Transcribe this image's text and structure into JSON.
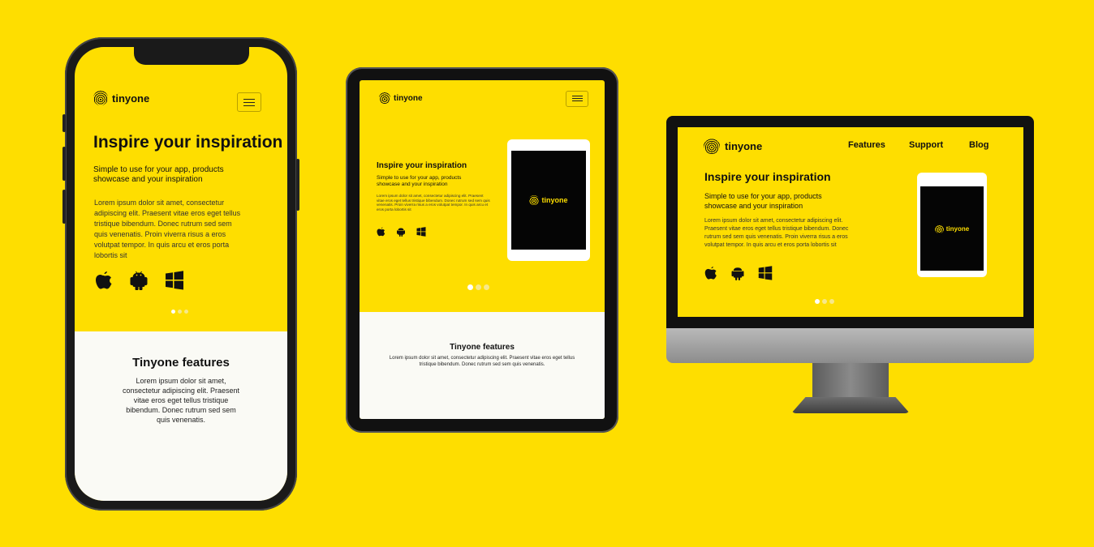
{
  "brand": {
    "name": "tinyone",
    "icon": "fingerprint-icon"
  },
  "hero": {
    "title": "Inspire your inspiration",
    "subtitle_line1": "Simple to use for your app, products",
    "subtitle_line2": "showcase and your inspiration",
    "body": "Lorem ipsum dolor sit amet, consectetur adipiscing elit. Praesent vitae eros eget tellus tristique bibendum. Donec rutrum sed sem quis venenatis. Proin viverra risus a eros volutpat tempor. In quis arcu et eros porta lobortis sit"
  },
  "platforms": [
    "apple-icon",
    "android-icon",
    "windows-icon"
  ],
  "carousel": {
    "count": 3,
    "active": 1
  },
  "features": {
    "title": "Tinyone features",
    "body": "Lorem ipsum dolor sit amet, consectetur adipiscing elit. Praesent vitae eros eget tellus tristique bibendum. Donec rutrum sed sem quis venenatis."
  },
  "nav": {
    "features": "Features",
    "support": "Support",
    "blog": "Blog"
  },
  "colors": {
    "accent": "#FEDE00",
    "dark": "#111111",
    "light": "#FAFAF5"
  }
}
